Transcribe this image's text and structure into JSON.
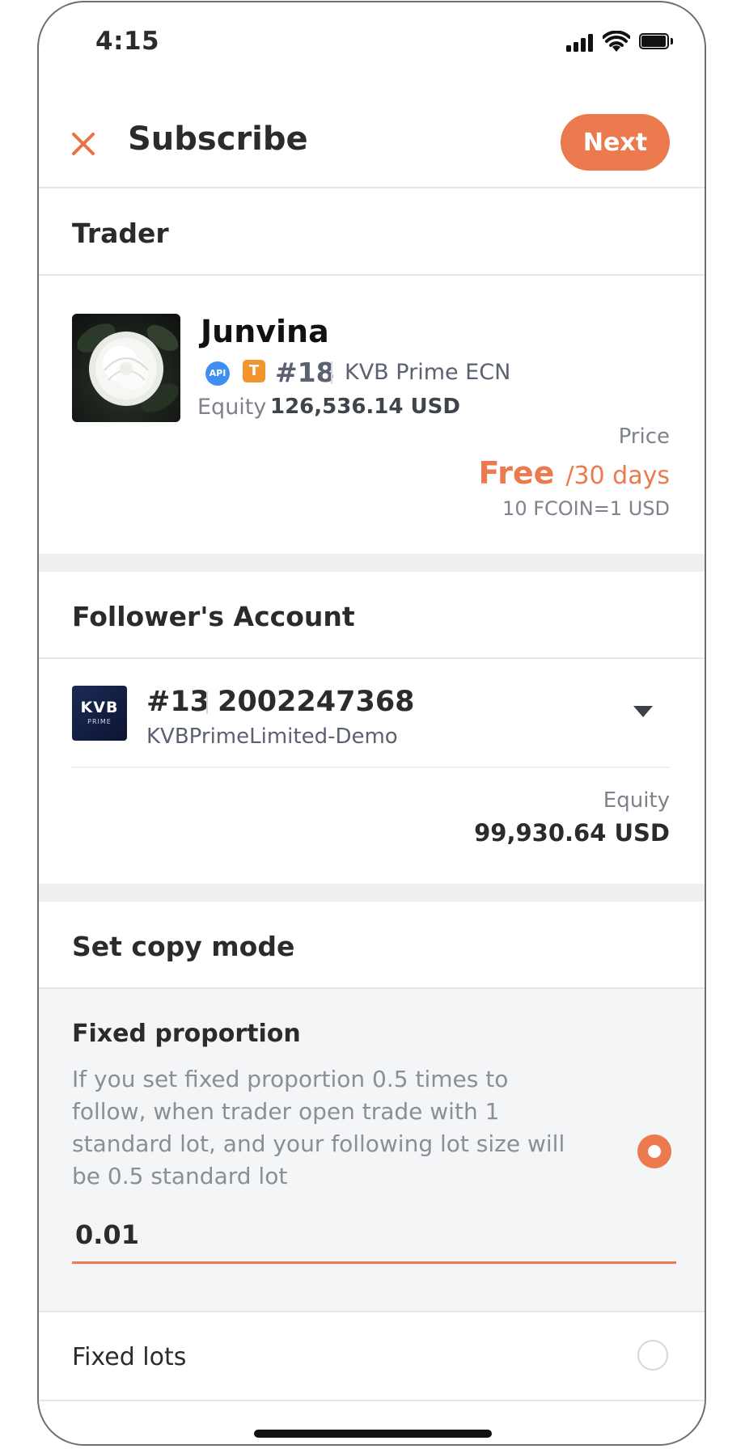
{
  "status_bar": {
    "time": "4:15"
  },
  "header": {
    "title": "Subscribe",
    "next_label": "Next"
  },
  "trader_section": {
    "title": "Trader",
    "name": "Junvina",
    "api_badge": "API",
    "t_badge": "T",
    "rank": "#18",
    "server": "KVB Prime ECN",
    "equity_label": "Equity",
    "equity_value": "126,536.14 USD",
    "price_label": "Price",
    "price_value": "Free",
    "price_period": "/30 days",
    "fcoin_rate": "10 FCOIN=1 USD"
  },
  "follower_section": {
    "title": "Follower's Account",
    "logo_text": "KVB",
    "logo_subtext": "PRIME",
    "account_rank": "#13",
    "account_number": "2002247368",
    "broker": "KVBPrimeLimited-Demo",
    "equity_label": "Equity",
    "equity_value": "99,930.64 USD"
  },
  "copy_mode_section": {
    "title": "Set copy mode",
    "fixed_proportion": {
      "title": "Fixed proportion",
      "description": "If you set fixed proportion 0.5 times to follow, when trader open trade with 1 standard lot, and your following lot size will be 0.5 standard lot",
      "value": "0.01",
      "selected": true
    },
    "fixed_lots": {
      "label": "Fixed lots",
      "selected": false
    }
  },
  "colors": {
    "accent": "#ec7a4f",
    "text": "#2b2b2b",
    "muted": "#8a8e97"
  }
}
